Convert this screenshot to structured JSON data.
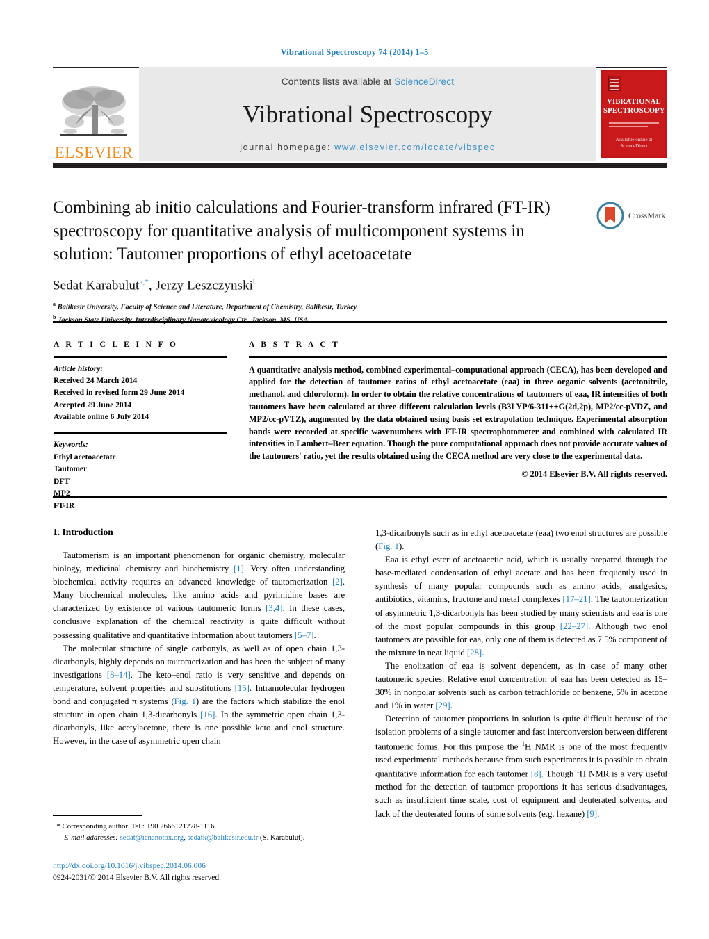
{
  "running_head": "Vibrational Spectroscopy 74 (2014) 1–5",
  "masthead": {
    "publisher_logo_text": "ELSEVIER",
    "contents_prefix": "Contents lists available at",
    "contents_link": "ScienceDirect",
    "journal_name": "Vibrational Spectroscopy",
    "homepage_prefix": "journal homepage:",
    "homepage_url": "www.elsevier.com/locate/vibspec",
    "cover": {
      "title_line1": "VIBRATIONAL",
      "title_line2": "SPECTROSCOPY",
      "foot_line1": "Available online at",
      "foot_line2": "ScienceDirect"
    }
  },
  "crossmark": {
    "label": "CrossMark"
  },
  "article": {
    "title": "Combining ab initio calculations and Fourier-transform infrared (FT-IR) spectroscopy for quantitative analysis of multicomponent systems in solution: Tautomer proportions of ethyl acetoacetate",
    "authors": [
      {
        "name": "Sedat Karabulut",
        "marks": "a,*"
      },
      {
        "name": "Jerzy Leszczynski",
        "marks": "b"
      }
    ],
    "authors_line": "Sedat Karabulut",
    "author2_line": ", Jerzy Leszczynski",
    "affiliations": [
      {
        "mark": "a",
        "text": "Balikesir University, Faculty of Science and Literature, Department of Chemistry, Balikesir, Turkey"
      },
      {
        "mark": "b",
        "text": "Jackson State University, Interdisciplinary Nanotoxicology Ctr., Jackson, MS, USA"
      }
    ]
  },
  "article_info": {
    "heading": "A R T I C L E   I N F O",
    "history_label": "Article history:",
    "history": [
      "Received 24 March 2014",
      "Received in revised form 29 June 2014",
      "Accepted 29 June 2014",
      "Available online 6 July 2014"
    ],
    "keywords_label": "Keywords:",
    "keywords": [
      "Ethyl acetoacetate",
      "Tautomer",
      "DFT",
      "MP2",
      "FT-IR"
    ]
  },
  "abstract": {
    "heading": "A B S T R A C T",
    "text": "A quantitative analysis method, combined experimental–computational approach (CECA), has been developed and applied for the detection of tautomer ratios of ethyl acetoacetate (eaa) in three organic solvents (acetonitrile, methanol, and chloroform). In order to obtain the relative concentrations of tautomers of eaa, IR intensities of both tautomers have been calculated at three different calculation levels (B3LYP/6-311++G(2d,2p), MP2/cc-pVDZ, and MP2/cc-pVTZ), augmented by the data obtained using basis set extrapolation technique. Experimental absorption bands were recorded at specific wavenumbers with FT-IR spectrophotometer and combined with calculated IR intensities in Lambert–Beer equation. Though the pure computational approach does not provide accurate values of the tautomers' ratio, yet the results obtained using the CECA method are very close to the experimental data.",
    "copyright": "© 2014 Elsevier B.V. All rights reserved."
  },
  "body": {
    "section_number_title": "1.  Introduction",
    "left_paragraphs": [
      "Tautomerism is an important phenomenon for organic chemistry, molecular biology, medicinal chemistry and biochemistry [1]. Very often understanding biochemical activity requires an advanced knowledge of tautomerization [2]. Many biochemical molecules, like amino acids and pyrimidine bases are characterized by existence of various tautomeric forms [3,4]. In these cases, conclusive explanation of the chemical reactivity is quite difficult without possessing qualitative and quantitative information about tautomers [5–7].",
      "The molecular structure of single carbonyls, as well as of open chain 1,3-dicarbonyls, highly depends on tautomerization and has been the subject of many investigations [8–14]. The keto–enol ratio is very sensitive and depends on temperature, solvent properties and substitutions [15]. Intramolecular hydrogen bond and conjugated π systems (Fig. 1) are the factors which stabilize the enol structure in open chain 1,3-dicarbonyls [16]. In the symmetric open chain 1,3-dicarbonyls, like acetylacetone, there is one possible keto and enol structure. However, in the case of asymmetric open chain"
    ],
    "right_paragraphs": [
      "1,3-dicarbonyls such as in ethyl acetoacetate (eaa) two enol structures are possible (Fig. 1).",
      "Eaa is ethyl ester of acetoacetic acid, which is usually prepared through the base-mediated condensation of ethyl acetate and has been frequently used in synthesis of many popular compounds such as amino acids, analgesics, antibiotics, vitamins, fructone and metal complexes [17–21]. The tautomerization of asymmetric 1,3-dicarbonyls has been studied by many scientists and eaa is one of the most popular compounds in this group [22–27]. Although two enol tautomers are possible for eaa, only one of them is detected as 7.5% component of the mixture in neat liquid [28].",
      "The enolization of eaa is solvent dependent, as in case of many other tautomeric species. Relative enol concentration of eaa has been detected as 15–30% in nonpolar solvents such as carbon tetrachloride or benzene, 5% in acetone and 1% in water [29].",
      "Detection of tautomer proportions in solution is quite difficult because of the isolation problems of a single tautomer and fast interconversion between different tautomeric forms. For this purpose the 1H NMR is one of the most frequently used experimental methods because from such experiments it is possible to obtain quantitative information for each tautomer [8]. Though 1H NMR is a very useful method for the detection of tautomer proportions it has serious disadvantages, such as insufficient time scale, cost of equipment and deuterated solvents, and lack of the deuterated forms of some solvents (e.g. hexane) [9]."
    ]
  },
  "footnote": {
    "star": "*",
    "corresponding": "Corresponding author. Tel.: +90 2666121278-1116.",
    "email_label": "E-mail addresses:",
    "email1": "sedat@icnanotox.org",
    "email_sep": ", ",
    "email2": "sedatk@balikesir.edu.tr",
    "email_suffix": " (S. Karabulut)."
  },
  "doi_block": {
    "doi": "http://dx.doi.org/10.1016/j.vibspec.2014.06.006",
    "issn": "0924-2031/© 2014 Elsevier B.V. All rights reserved."
  },
  "colors": {
    "link_blue": "#1f7fbf",
    "elsevier_orange": "#f08c1e",
    "cover_red": "#c9191b",
    "rule_black": "#231f20"
  }
}
